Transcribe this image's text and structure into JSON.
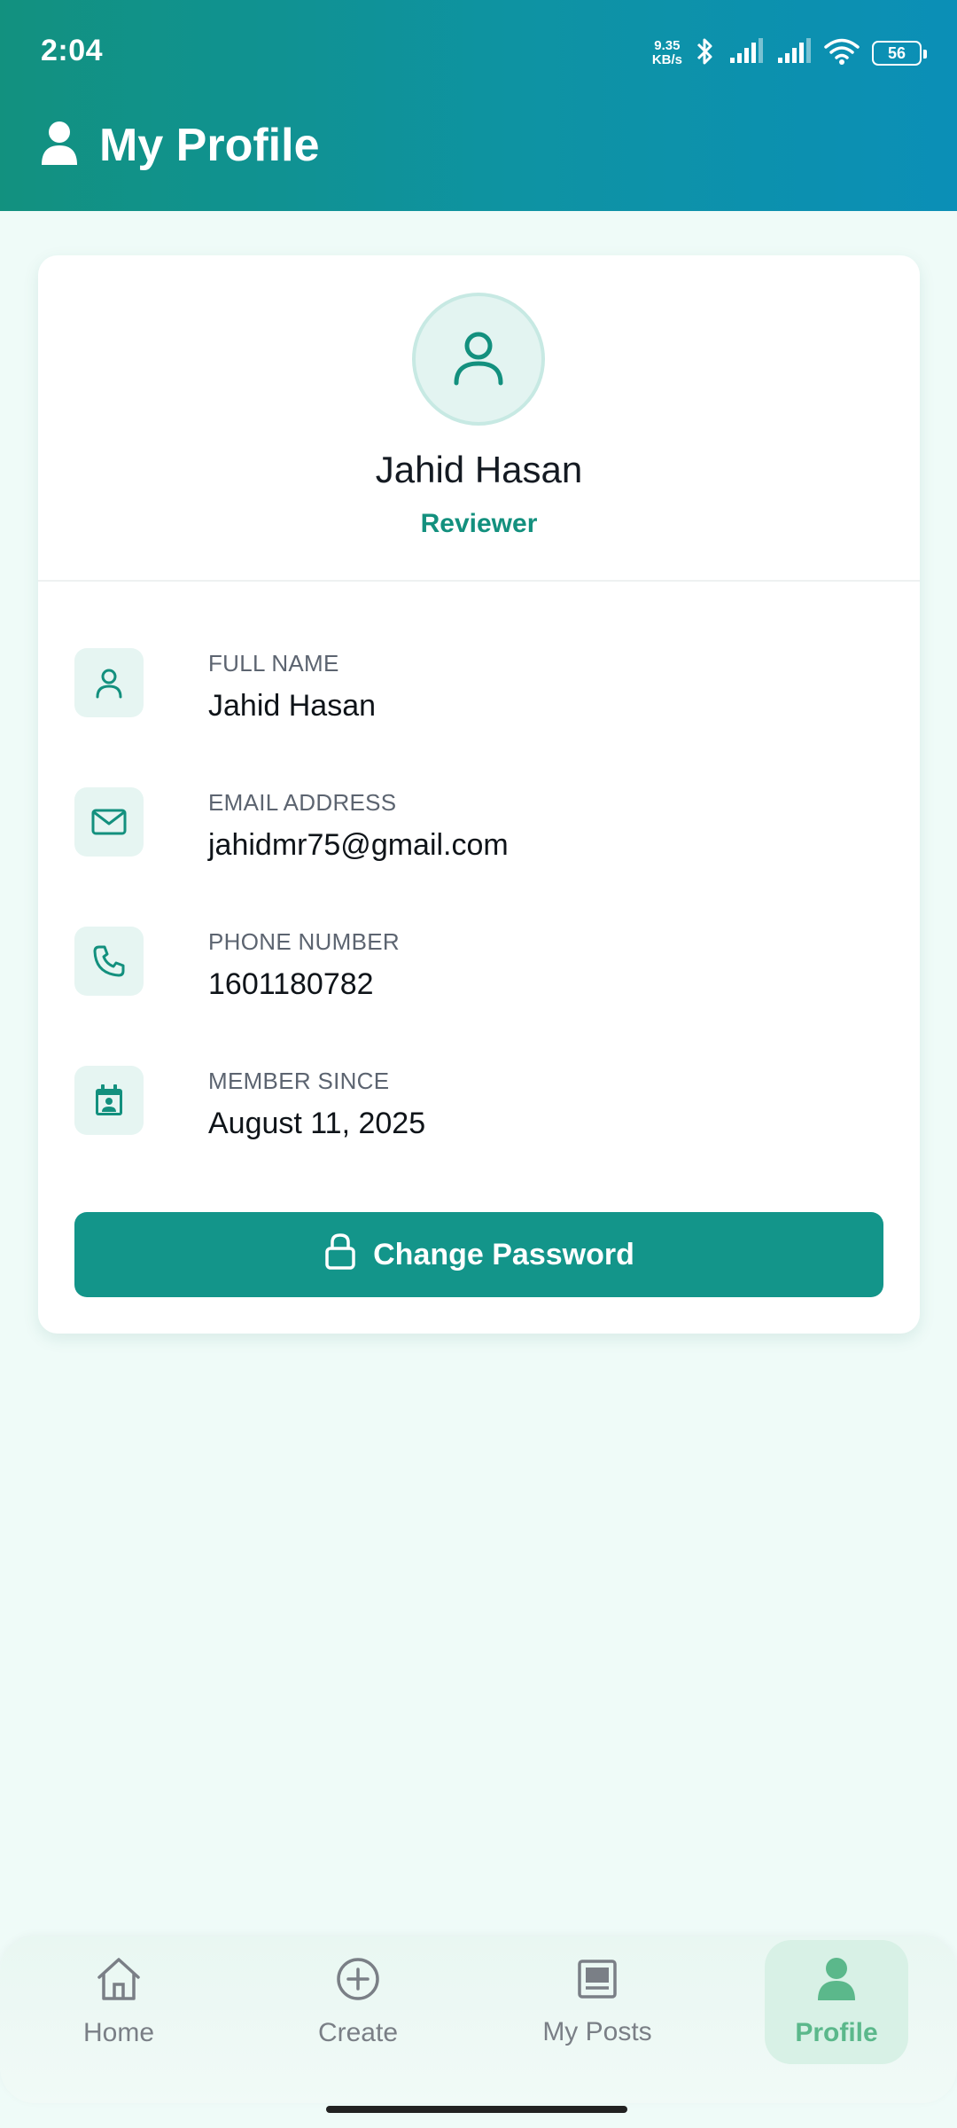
{
  "status_bar": {
    "time": "2:04",
    "net_speed_value": "9.35",
    "net_speed_unit": "KB/s",
    "battery": "56"
  },
  "header": {
    "title": "My Profile"
  },
  "profile": {
    "name": "Jahid Hasan",
    "role": "Reviewer"
  },
  "details": [
    {
      "label": "FULL NAME",
      "value": "Jahid Hasan",
      "icon": "person-icon"
    },
    {
      "label": "EMAIL ADDRESS",
      "value": "jahidmr75@gmail.com",
      "icon": "mail-icon"
    },
    {
      "label": "PHONE NUMBER",
      "value": "1601180782",
      "icon": "phone-icon"
    },
    {
      "label": "MEMBER SINCE",
      "value": "August 11, 2025",
      "icon": "calendar-icon"
    }
  ],
  "actions": {
    "change_password": "Change Password"
  },
  "nav": [
    {
      "label": "Home",
      "icon": "home-icon",
      "active": false
    },
    {
      "label": "Create",
      "icon": "plus-circle-icon",
      "active": false
    },
    {
      "label": "My Posts",
      "icon": "posts-icon",
      "active": false
    },
    {
      "label": "Profile",
      "icon": "person-icon",
      "active": true
    }
  ],
  "colors": {
    "primary": "#13958a",
    "header_start": "#12917f",
    "header_end": "#0b8fb7",
    "background": "#effbf8",
    "active_nav": "#5bb88b"
  }
}
